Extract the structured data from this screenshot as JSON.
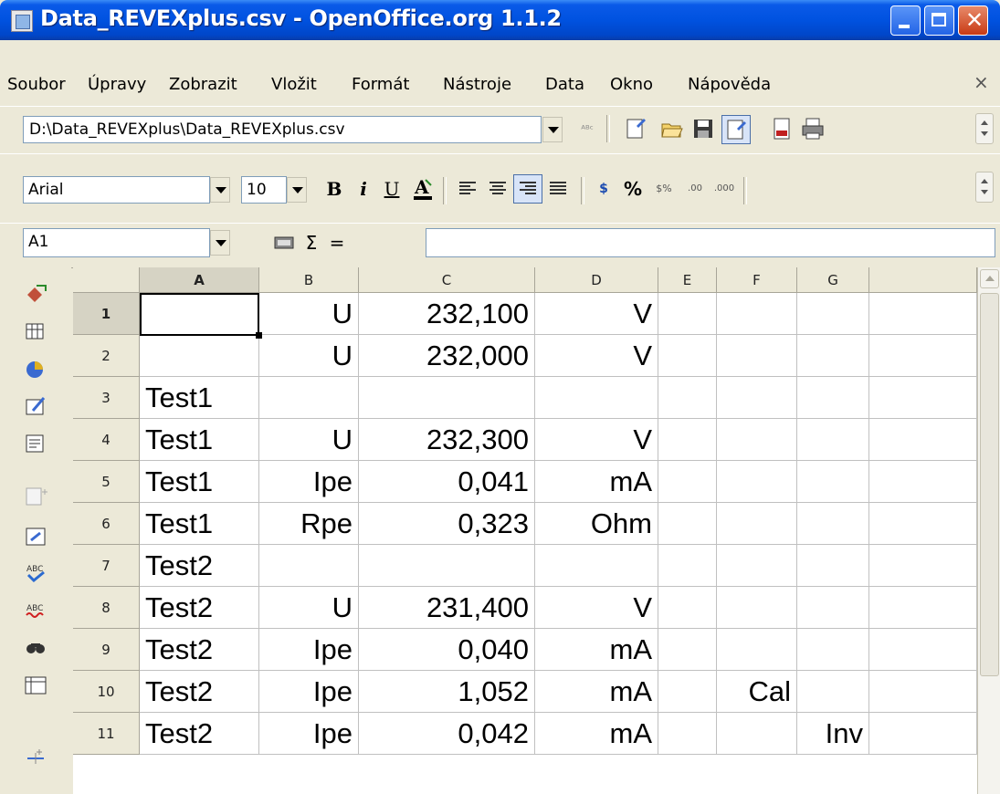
{
  "window": {
    "title": "Data_REVEXplus.csv - OpenOffice.org 1.1.2"
  },
  "menu": [
    {
      "label": "Soubor"
    },
    {
      "label": "Úpravy"
    },
    {
      "label": "Zobrazit"
    },
    {
      "label": "Vložit"
    },
    {
      "label": "Formát"
    },
    {
      "label": "Nástroje"
    },
    {
      "label": "Data"
    },
    {
      "label": "Okno"
    },
    {
      "label": "Nápověda"
    }
  ],
  "doc_close": "×",
  "function_bar": {
    "url": "D:\\Data_REVEXplus\\Data_REVEXplus.csv"
  },
  "format_bar": {
    "font": "Arial",
    "size": "10",
    "bold": "B",
    "italic": "i",
    "underline": "U"
  },
  "formula_bar": {
    "cell_ref": "A1",
    "sum": "Σ",
    "equals": "=",
    "content": ""
  },
  "sheet": {
    "columns": [
      "A",
      "B",
      "C",
      "D",
      "E",
      "F",
      "G"
    ],
    "rows": [
      {
        "num": "1",
        "cells": [
          "",
          "U",
          "232,100",
          "V",
          "",
          "",
          ""
        ]
      },
      {
        "num": "2",
        "cells": [
          "",
          "U",
          "232,000",
          "V",
          "",
          "",
          ""
        ]
      },
      {
        "num": "3",
        "cells": [
          "Test1",
          "",
          "",
          "",
          "",
          "",
          ""
        ]
      },
      {
        "num": "4",
        "cells": [
          "Test1",
          "U",
          "232,300",
          "V",
          "",
          "",
          ""
        ]
      },
      {
        "num": "5",
        "cells": [
          "Test1",
          "Ipe",
          "0,041",
          "mA",
          "",
          "",
          ""
        ]
      },
      {
        "num": "6",
        "cells": [
          "Test1",
          "Rpe",
          "0,323",
          "Ohm",
          "",
          "",
          ""
        ]
      },
      {
        "num": "7",
        "cells": [
          "Test2",
          "",
          "",
          "",
          "",
          "",
          ""
        ]
      },
      {
        "num": "8",
        "cells": [
          "Test2",
          "U",
          "231,400",
          "V",
          "",
          "",
          ""
        ]
      },
      {
        "num": "9",
        "cells": [
          "Test2",
          "Ipe",
          "0,040",
          "mA",
          "",
          "",
          ""
        ]
      },
      {
        "num": "10",
        "cells": [
          "Test2",
          "Ipe",
          "1,052",
          "mA",
          "",
          "Cal",
          ""
        ]
      },
      {
        "num": "11",
        "cells": [
          "Test2",
          "Ipe",
          "0,042",
          "mA",
          "",
          "",
          "Inv"
        ]
      }
    ]
  }
}
